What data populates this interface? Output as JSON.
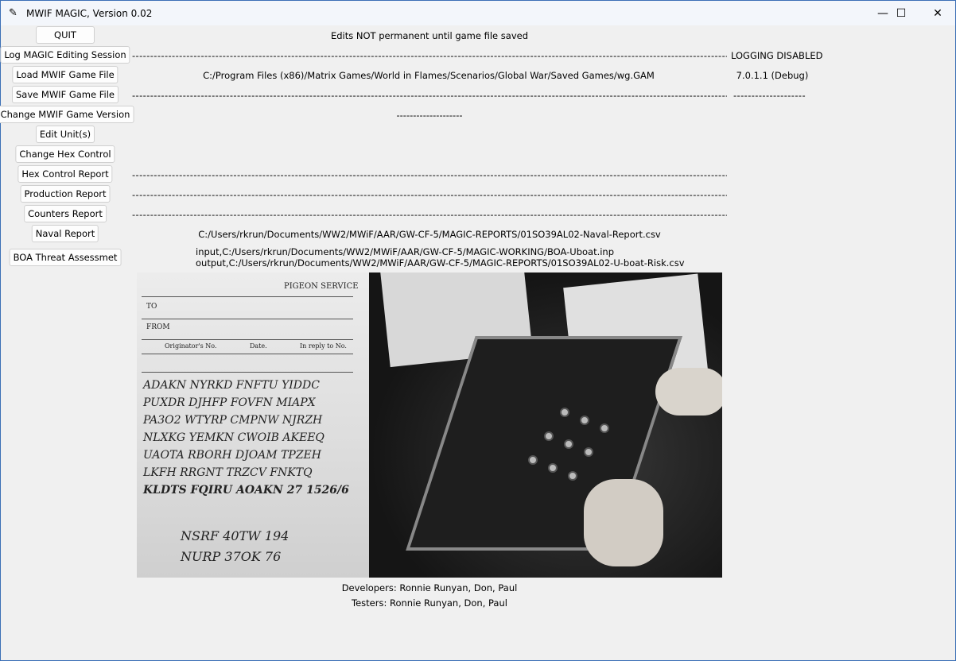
{
  "window": {
    "title": "MWIF MAGIC, Version 0.02",
    "minimize": "—",
    "maximize": "☐",
    "close": "✕"
  },
  "buttons": {
    "quit": "QUIT",
    "log": "Log MAGIC Editing Session",
    "load": "Load MWIF Game File",
    "save": "Save MWIF Game File",
    "change_version": "Change MWIF Game Version",
    "edit_units": "Edit Unit(s)",
    "change_hex": "Change Hex Control",
    "hex_report": "Hex Control Report",
    "production": "Production Report",
    "counters": "Counters Report",
    "naval": "Naval Report",
    "boa": "BOA Threat Assessmet"
  },
  "status": {
    "edits_notice": "Edits NOT permanent until game file saved",
    "logging": "LOGGING DISABLED",
    "game_file": "C:/Program Files (x86)/Matrix Games/World in Flames/Scenarios/Global War/Saved Games/wg.GAM",
    "version": "7.0.1.1 (Debug)",
    "version_change": "--------------------",
    "naval_path": "C:/Users/rkrun/Documents/WW2/MWiF/AAR/GW-CF-5/MAGIC-REPORTS/01SO39AL02-Naval-Report.csv",
    "boa_input": "input,C:/Users/rkrun/Documents/WW2/MWiF/AAR/GW-CF-5/MAGIC-WORKING/BOA-Uboat.inp",
    "boa_output": "output,C:/Users/rkrun/Documents/WW2/MWiF/AAR/GW-CF-5/MAGIC-REPORTS/01SO39AL02-U-boat-Risk.csv",
    "dashes": "--------------------------------------------------------------------------------------------------------------------------------------------------------------------------------------------------------------------------------------------------------------",
    "save_right": "--------------------"
  },
  "image": {
    "pigeon": "PIGEON SERVICE",
    "to": "TO",
    "from": "FROM",
    "orig": "Originator's No.",
    "date": "Date.",
    "reply": "In reply to No.",
    "lines": [
      "ADAKN  NYRKD  FNFTU  YIDDC",
      "PUXDR  DJHFP  FOVFN  MIAPX",
      "PA3O2  WTYRP  CMPNW  NJRZH",
      "NLXKG  YEMKN  CWOIB  AKEEQ",
      "UAOTA  RBORH  DJOAM  TPZEH",
      "LKFH   RRGNT  TRZCV  FNKTQ",
      "KLDTS  FQIRU  AOAKN  27  1526/6",
      "NSRF  40TW  194",
      "NURP  37OK  76"
    ]
  },
  "credits": {
    "developers": "Developers: Ronnie Runyan, Don, Paul",
    "testers": "Testers: Ronnie Runyan, Don, Paul"
  }
}
